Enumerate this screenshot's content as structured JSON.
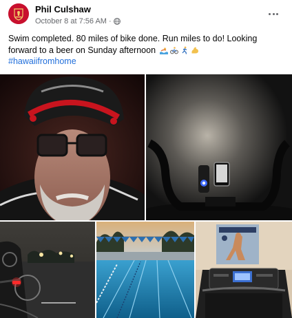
{
  "post": {
    "author": "Phil Culshaw",
    "date": "October 8 at 7:56 AM",
    "separator": "·",
    "text": "Swim completed. 80 miles of bike done. Run miles to do! Looking forward to a beer on Sunday afternoon",
    "emojis": [
      "swimmer-emoji",
      "cyclist-emoji",
      "runner-emoji",
      "flexed-biceps-emoji"
    ],
    "hashtag": "#hawaiifromhome"
  },
  "photos": [
    {
      "name": "selfie-helmet-photo"
    },
    {
      "name": "bike-light-handlebars-photo"
    },
    {
      "name": "parking-lot-night-photo"
    },
    {
      "name": "swimming-pool-photo"
    },
    {
      "name": "treadmill-photo"
    }
  ],
  "colors": {
    "link": "#216fdb",
    "meta": "#65676b",
    "avatar": "#c8102e"
  }
}
